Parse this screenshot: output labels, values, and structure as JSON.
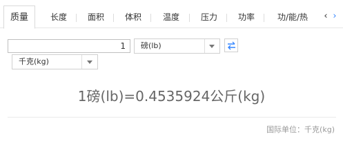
{
  "tabs": [
    {
      "label": "质量",
      "active": true
    },
    {
      "label": "长度",
      "active": false
    },
    {
      "label": "面积",
      "active": false
    },
    {
      "label": "体积",
      "active": false
    },
    {
      "label": "温度",
      "active": false
    },
    {
      "label": "压力",
      "active": false
    },
    {
      "label": "功率",
      "active": false
    },
    {
      "label": "功/能/热",
      "active": false
    }
  ],
  "converter": {
    "input_value": "1",
    "from_unit": "磅(lb)",
    "to_unit": "千克(kg)"
  },
  "result_text": "1磅(lb)=0.4535924公斤(kg)",
  "footer": {
    "standard_label": "国际单位：千克(kg)"
  },
  "icons": {
    "prev": "chevron-left-icon",
    "next": "chevron-right-icon",
    "swap": "swap-arrows-icon",
    "dropdown": "caret-down-icon"
  },
  "colors": {
    "accent": "#3385ff",
    "result_text": "#666666",
    "muted_text": "#999999"
  }
}
